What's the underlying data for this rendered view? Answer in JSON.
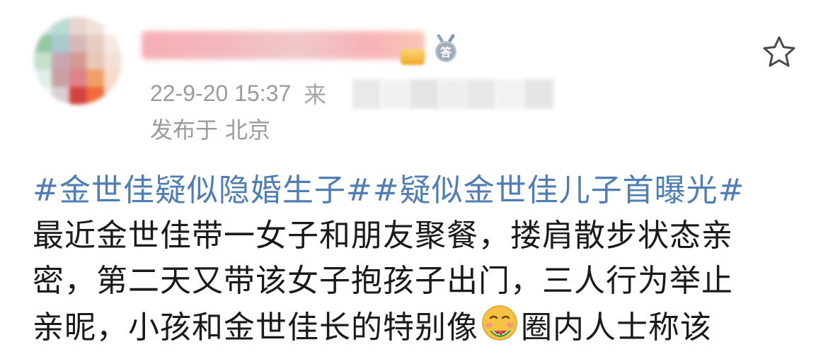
{
  "post": {
    "header": {
      "username": "",
      "timestamp": "22-9-20 15:37",
      "source_prefix": "来",
      "location": "发布于 北京",
      "medal_icon": "answer-medal-icon",
      "medal_char": "答",
      "favorite_icon": "star-outline-icon"
    },
    "body": {
      "topic_1": "#金世佳疑似隐婚生子#",
      "topic_2": "#疑似金世佳儿子首曝光#",
      "line_2": "最近金世佳带一女子和朋友聚餐，搂肩散步状态亲",
      "line_3": "密，第二天又带该女子抱孩子出门，三人行为举止",
      "line_4a": "亲昵，小孩和金世佳长的特别像",
      "emoji": "eating-watermelon-emoji",
      "line_4b": "圈内人士称该"
    }
  },
  "colors": {
    "topic_link": "#4f7db5",
    "body_text": "#1a1a1a",
    "meta_text": "#9b9b9b",
    "background": "#ffffff"
  }
}
